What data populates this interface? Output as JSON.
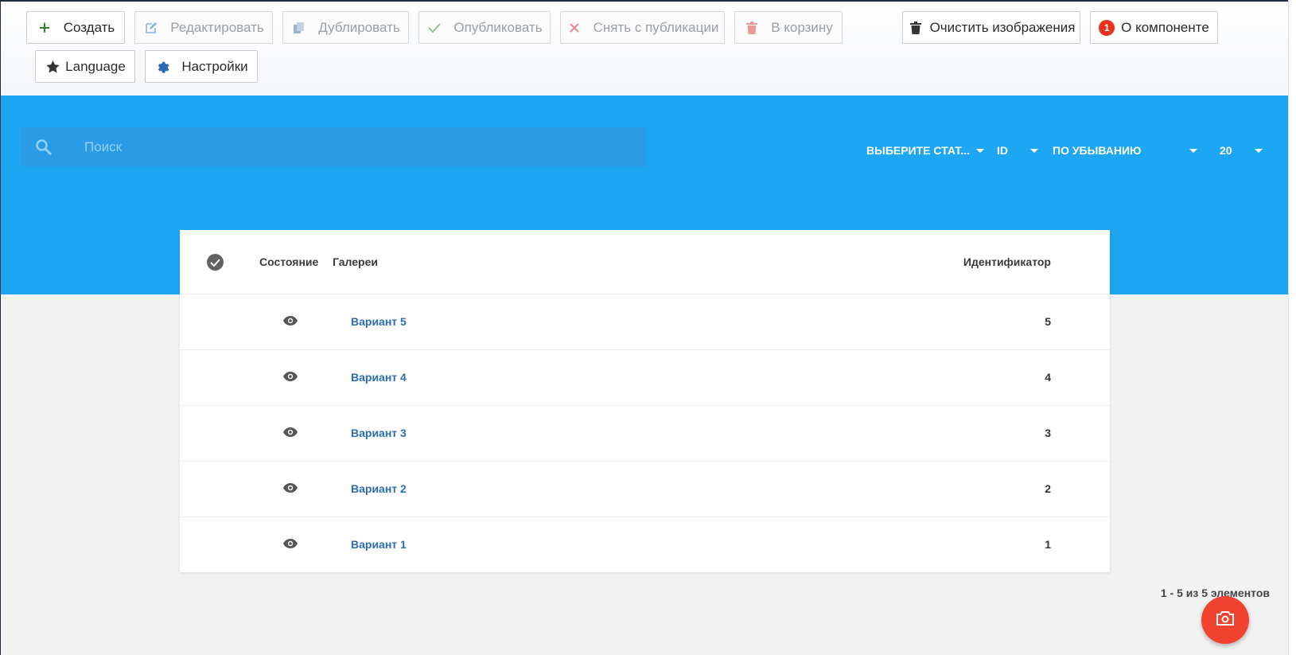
{
  "toolbar": {
    "create": "Создать",
    "edit": "Редактировать",
    "duplicate": "Дублировать",
    "publish": "Опубликовать",
    "unpublish": "Снять с публикации",
    "trash": "В корзину",
    "clear_images": "Очистить изображения",
    "about_badge": "1",
    "about": "О компоненте",
    "language": "Language",
    "settings": "Настройки"
  },
  "filters": {
    "search_placeholder": "Поиск",
    "status_select": "ВЫБЕРИТЕ СТАТ...",
    "order_field": "ID",
    "order_direction": "ПО УБЫВАНИЮ",
    "page_size": "20"
  },
  "table": {
    "headers": {
      "status": "Состояние",
      "galleries": "Галереи",
      "id": "Идентификатор"
    },
    "rows": [
      {
        "name": "Вариант 5",
        "id": "5"
      },
      {
        "name": "Вариант 4",
        "id": "4"
      },
      {
        "name": "Вариант 3",
        "id": "3"
      },
      {
        "name": "Вариант 2",
        "id": "2"
      },
      {
        "name": "Вариант 1",
        "id": "1"
      }
    ]
  },
  "pagination": {
    "summary": "1 - 5 из 5 элементов"
  },
  "colors": {
    "header_blue": "#1da6f2",
    "link": "#2a6db0",
    "fab": "#f0422f",
    "badge": "#e8321e"
  }
}
